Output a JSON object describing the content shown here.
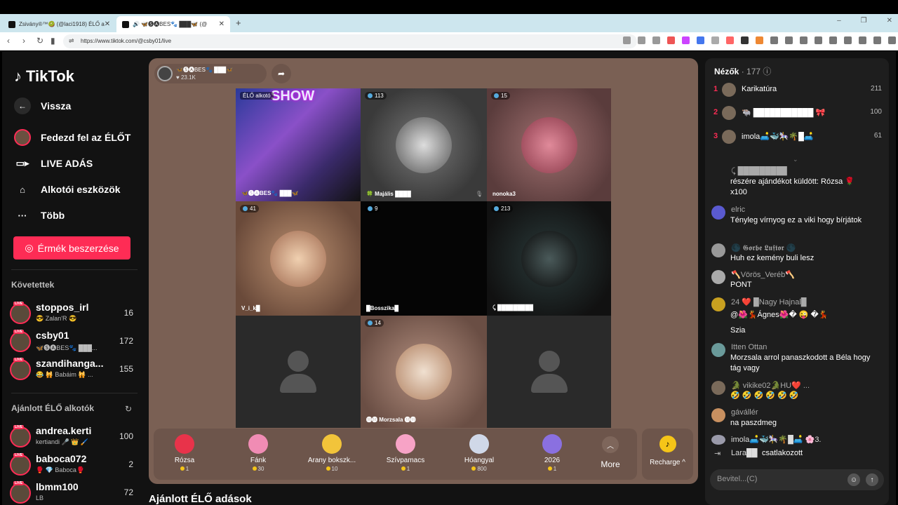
{
  "browser": {
    "tabs": [
      {
        "label": "Zsivány®™🥝 (@laci1918) ÉLŐ a"
      },
      {
        "label": "🔊 🦋🅢🅐BES🐾 ███🦋 (@"
      }
    ],
    "url": "https://www.tiktok.com/@csby01/live"
  },
  "sidebar": {
    "logo": "TikTok",
    "back": "Vissza",
    "nav": [
      {
        "label": "Fedezd fel az ÉLŐT",
        "icon": "avatar-icon"
      },
      {
        "label": "LIVE ADÁS",
        "icon": "video-camera-icon"
      },
      {
        "label": "Alkotói eszközök",
        "icon": "creator-tools-icon"
      },
      {
        "label": "Több",
        "icon": "more-icon"
      }
    ],
    "coins_button": "Érmék beszerzése",
    "following_header": "Követettek",
    "following": [
      {
        "name": "stoppos_irl",
        "sub": "😎 Zalan'R 😎",
        "count": "16"
      },
      {
        "name": "csby01",
        "sub": "🦋🅢🅐BES🐾 ███...",
        "count": "172"
      },
      {
        "name": "szandihanga...",
        "sub": "😂 🙀 Babáim 🙀 ...",
        "count": "155"
      }
    ],
    "recommended_header": "Ajánlott ÉLŐ alkotók",
    "recommended": [
      {
        "name": "andrea.kerti",
        "sub": "kertiandi 🎤 👑 🖌️",
        "count": "100"
      },
      {
        "name": "baboca072",
        "sub": "🥊 💎 Baboca🥊",
        "count": "2"
      },
      {
        "name": "lbmm100",
        "sub": "LB",
        "count": "72"
      }
    ]
  },
  "stream": {
    "host_name": "🦋🅢🅐BES🐾 ███🦋",
    "host_likes": "♥ 23.1K",
    "cells": [
      {
        "label": "",
        "count": "",
        "tag": "ÉLŐ alkotó",
        "footer": "🦋🅢🅐BES🐾 ███🦋",
        "title": "SHOW"
      },
      {
        "label": "",
        "count": "113",
        "footer": "🍀 Majális ████"
      },
      {
        "label": "",
        "count": "15",
        "footer": "nonoka3"
      },
      {
        "label": "",
        "count": "41",
        "footer": "V_i_k█"
      },
      {
        "label": "",
        "count": "9",
        "footer": "█Bosszika█"
      },
      {
        "label": "",
        "count": "213",
        "footer": "⤹ █████████"
      },
      {
        "label": "",
        "count": "",
        "footer": ""
      },
      {
        "label": "",
        "count": "14",
        "footer": "🅜🅜 Morzsala 🅜🅜"
      },
      {
        "label": "",
        "count": "",
        "footer": ""
      }
    ]
  },
  "gifts": [
    {
      "name": "Rózsa",
      "price": "1",
      "color": "#e8334a"
    },
    {
      "name": "Fánk",
      "price": "30",
      "color": "#f08cb4"
    },
    {
      "name": "Arany bokszk...",
      "price": "10",
      "color": "#f2c43a"
    },
    {
      "name": "Szívpamacs",
      "price": "1",
      "color": "#f7a3c6"
    },
    {
      "name": "Hóangyal",
      "price": "800",
      "color": "#d0d8e8"
    },
    {
      "name": "2026",
      "price": "1",
      "color": "#8a70e0"
    }
  ],
  "more_label": "More",
  "recharge_label": "Recharge ^",
  "below_title": "Ajánlott ÉLŐ adások",
  "panel": {
    "viewers_label": "Nézők",
    "viewers_count": "· 177",
    "ranking": [
      {
        "rank": "1",
        "name": "Karikatúra",
        "score": "211"
      },
      {
        "rank": "2",
        "name": "🐃 ███████████ 🎀",
        "score": "100"
      },
      {
        "rank": "3",
        "name": "imola🛋️🐳🎠🌴█🛋️",
        "score": "61"
      }
    ],
    "messages": [
      {
        "user": "⤹ █████████",
        "text": "részére ajándékot küldött: Rózsa 🌹 x100"
      },
      {
        "user": "elric",
        "text": "Tényleg vírnyog ez a viki hogy bírjátok"
      },
      {
        "user": "🌑 𝕲𝖔𝖗𝖇𝖊 𝕷𝖚𝖋𝖙𝖔𝖗 🌑",
        "text": "Huh ez kemény buli lesz"
      },
      {
        "user": "🪓Vörös_Veréb🪓",
        "text": "PONT"
      },
      {
        "user": "24 ❤️ █Nagy Hajnal█",
        "text": "@🌺💃Ágnes🌺� 😜 �💃"
      },
      {
        "user": "",
        "text": "Szia"
      },
      {
        "user": "Itten Ottan",
        "text": "Morzsala arrol panaszkodott a Béla hogy tág vagy"
      },
      {
        "user": "🐊 vikike02🐊HU❤️ ...",
        "text": "🤣 🤣 🤣 🤣 🤣 🤣"
      },
      {
        "user": "gávállér",
        "text": "na paszdmeg"
      },
      {
        "user": "imola🛋️🐳🎠🌴█🛋️ 🌸3.",
        "text": ""
      },
      {
        "user": "Lara██",
        "text": "csatlakozott"
      }
    ],
    "input_placeholder": "Bevitel...(C)"
  }
}
